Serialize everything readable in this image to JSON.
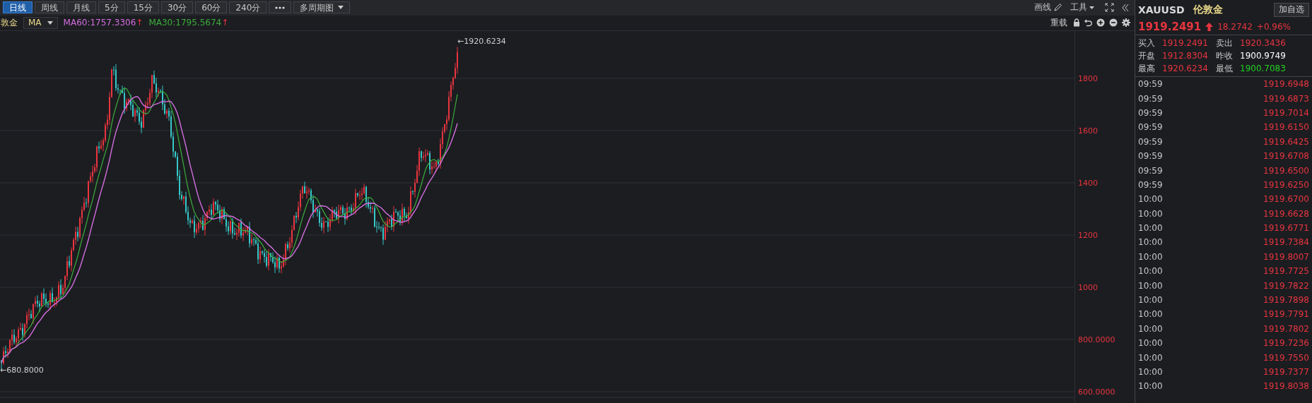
{
  "toolbar": {
    "periods": [
      {
        "label": "日线",
        "selected": true
      },
      {
        "label": "周线",
        "selected": false
      },
      {
        "label": "月线",
        "selected": false
      },
      {
        "label": "5分",
        "selected": false
      },
      {
        "label": "15分",
        "selected": false
      },
      {
        "label": "30分",
        "selected": false
      },
      {
        "label": "60分",
        "selected": false
      },
      {
        "label": "240分",
        "selected": false
      }
    ],
    "multi_period": "多周期图",
    "draw_line": "画线",
    "tools": "工具"
  },
  "indicator_bar": {
    "symbol_name": "敦金",
    "indicator": "MA",
    "ma_values": [
      {
        "label": "MA60:1757.3306",
        "trend": "↑",
        "color": "#d46ee0"
      },
      {
        "label": "MA30:1795.5674",
        "trend": "↑",
        "color": "#3cae3c"
      }
    ],
    "reload": "重载"
  },
  "chart": {
    "price_axis": [
      "1800",
      "1600",
      "1400",
      "1200",
      "1000",
      "800.0000",
      "600.0000"
    ],
    "high_label": "←1920.6234",
    "low_label": "←680.8000"
  },
  "quote": {
    "symbol": "XAUUSD",
    "name": "伦敦金",
    "watch_button": "加自选",
    "price": "1919.2491",
    "change": "18.2742",
    "change_pct": "+0.96%",
    "details": [
      {
        "label": "买入",
        "value": "1919.2491",
        "color": "#e8353f"
      },
      {
        "label": "卖出",
        "value": "1920.3436",
        "color": "#e8353f"
      },
      {
        "label": "开盘",
        "value": "1912.8304",
        "color": "#e8353f"
      },
      {
        "label": "昨收",
        "value": "1900.9749",
        "color": "#ffffff"
      },
      {
        "label": "最高",
        "value": "1920.6234",
        "color": "#e8353f"
      },
      {
        "label": "最低",
        "value": "1900.7083",
        "color": "#22d022"
      }
    ]
  },
  "ticks": [
    {
      "time": "09:59",
      "price": "1919.6948"
    },
    {
      "time": "09:59",
      "price": "1919.6873"
    },
    {
      "time": "09:59",
      "price": "1919.7014"
    },
    {
      "time": "09:59",
      "price": "1919.6150"
    },
    {
      "time": "09:59",
      "price": "1919.6425"
    },
    {
      "time": "09:59",
      "price": "1919.6708"
    },
    {
      "time": "09:59",
      "price": "1919.6500"
    },
    {
      "time": "09:59",
      "price": "1919.6250"
    },
    {
      "time": "10:00",
      "price": "1919.6700"
    },
    {
      "time": "10:00",
      "price": "1919.6628"
    },
    {
      "time": "10:00",
      "price": "1919.6771"
    },
    {
      "time": "10:00",
      "price": "1919.7384"
    },
    {
      "time": "10:00",
      "price": "1919.8007"
    },
    {
      "time": "10:00",
      "price": "1919.7725"
    },
    {
      "time": "10:00",
      "price": "1919.7822"
    },
    {
      "time": "10:00",
      "price": "1919.7898"
    },
    {
      "time": "10:00",
      "price": "1919.7791"
    },
    {
      "time": "10:00",
      "price": "1919.7802"
    },
    {
      "time": "10:00",
      "price": "1919.7236"
    },
    {
      "time": "10:00",
      "price": "1919.7550"
    },
    {
      "time": "10:00",
      "price": "1919.7377"
    },
    {
      "time": "10:00",
      "price": "1919.8038"
    }
  ]
}
